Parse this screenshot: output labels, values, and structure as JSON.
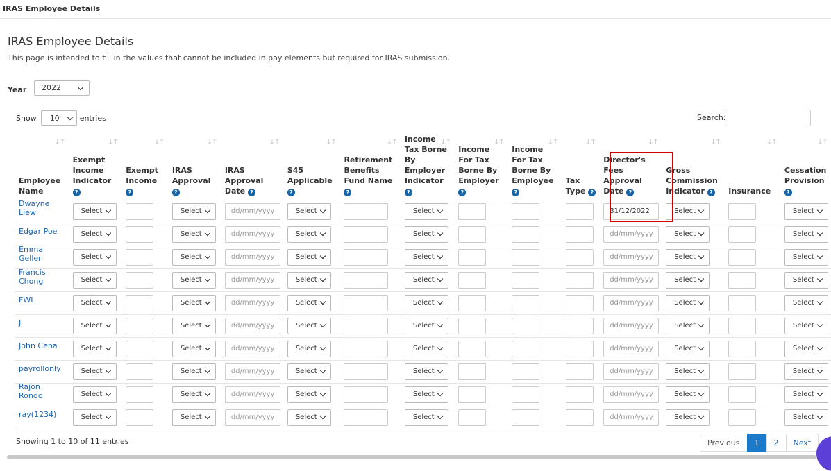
{
  "topbar": {
    "title": "IRAS Employee Details"
  },
  "page": {
    "title": "IRAS Employee Details",
    "description": "This page is intended to fill in the values that cannot be included in pay elements but required for IRAS submission."
  },
  "year": {
    "label": "Year",
    "value": "2022"
  },
  "length": {
    "show": "Show",
    "value": "10",
    "entries": "entries"
  },
  "search": {
    "label": "Search:"
  },
  "columns": [
    {
      "label": "Employee Name",
      "help": false
    },
    {
      "label": "Exempt Income Indicator",
      "help": true
    },
    {
      "label": "Exempt Income",
      "help": true
    },
    {
      "label": "IRAS Approval",
      "help": true
    },
    {
      "label": "IRAS Approval Date",
      "help": true
    },
    {
      "label": "S45 Applicable",
      "help": true
    },
    {
      "label": "Retirement Benefits Fund Name",
      "help": true
    },
    {
      "label": "Income Tax Borne By Employer Indicator",
      "help": true
    },
    {
      "label": "Income For Tax Borne By Employer",
      "help": true
    },
    {
      "label": "Income For Tax Borne By Employee",
      "help": true
    },
    {
      "label": "Tax Type",
      "help": true
    },
    {
      "label": "Director's Fees Approval Date",
      "help": true
    },
    {
      "label": "Gross Commission Indicator",
      "help": true
    },
    {
      "label": "Insurance",
      "help": false
    },
    {
      "label": "Cessation Provision",
      "help": true
    }
  ],
  "select_placeholder": "Select",
  "date_placeholder": "dd/mm/yyyy",
  "employees": [
    {
      "name": "Dwayne Liew",
      "directors_fees_date": "31/12/2022"
    },
    {
      "name": "Edgar Poe",
      "directors_fees_date": ""
    },
    {
      "name": "Emma Geller",
      "directors_fees_date": ""
    },
    {
      "name": "Francis Chong",
      "directors_fees_date": ""
    },
    {
      "name": "FWL",
      "directors_fees_date": ""
    },
    {
      "name": "J",
      "directors_fees_date": ""
    },
    {
      "name": "John Cena",
      "directors_fees_date": ""
    },
    {
      "name": "payrollonly",
      "directors_fees_date": ""
    },
    {
      "name": "Rajon Rondo",
      "directors_fees_date": ""
    },
    {
      "name": "ray(1234)",
      "directors_fees_date": ""
    }
  ],
  "footer": {
    "info": "Showing 1 to 10 of 11 entries",
    "pagination": {
      "previous": "Previous",
      "pages": [
        "1",
        "2"
      ],
      "next": "Next"
    }
  },
  "colors": {
    "link": "#1b64b0",
    "active_page": "#1b7ac9",
    "highlight": "#d40000"
  }
}
